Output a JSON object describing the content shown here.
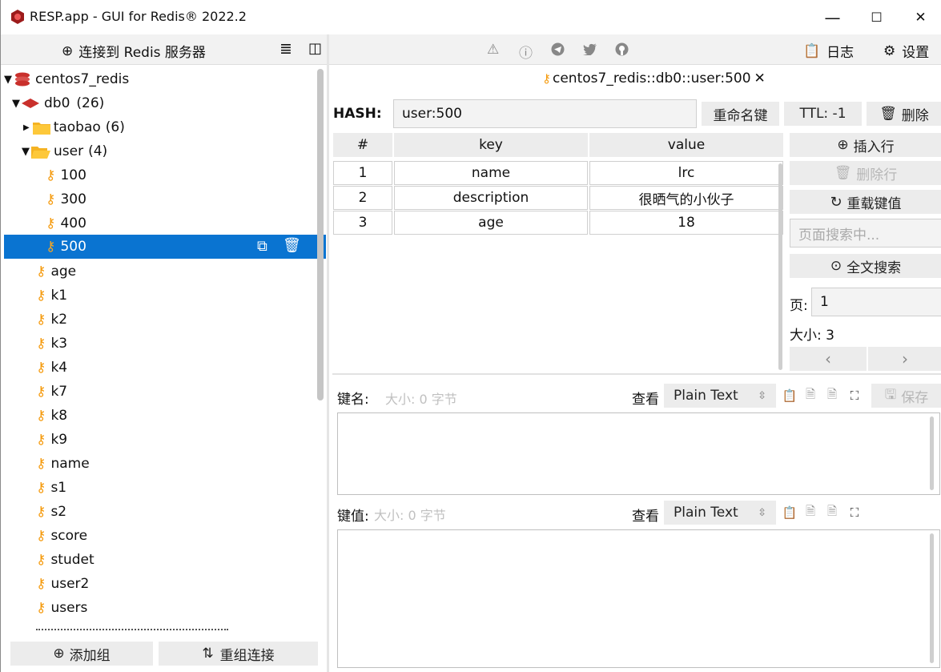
{
  "window": {
    "title": "RESP.app - GUI for Redis® 2022.2",
    "minimize": "—",
    "maximize": "☐",
    "close": "✕"
  },
  "left_panel": {
    "connect_button": "连接到 Redis 服务器",
    "list_icon": "≣",
    "panel_icon": "◫",
    "tree": {
      "connection": "centos7_redis",
      "db": "db0",
      "db_count": "(26)",
      "folders": [
        {
          "name": "taobao",
          "count": "(6)"
        },
        {
          "name": "user",
          "count": "(4)"
        }
      ],
      "user_keys": [
        "100",
        "300",
        "400",
        "500"
      ],
      "keys": [
        "age",
        "k1",
        "k2",
        "k3",
        "k4",
        "k7",
        "k8",
        "k9",
        "name",
        "s1",
        "s2",
        "score",
        "studet",
        "user2",
        "users"
      ]
    },
    "add_group_button": "添加组",
    "regroup_button": "重组连接"
  },
  "toolbar": {
    "log_button": "日志",
    "settings_button": "设置"
  },
  "tab": {
    "title": "centos7_redis::db0::user:500",
    "close": "✕"
  },
  "key_header": {
    "type_label": "HASH:",
    "key_name": "user:500",
    "rename_button": "重命名键",
    "ttl_button": "TTL:  -1",
    "delete_button": "删除"
  },
  "table": {
    "headers": [
      "#",
      "key",
      "value"
    ],
    "rows": [
      {
        "index": "1",
        "key": "name",
        "value": "lrc"
      },
      {
        "index": "2",
        "key": "description",
        "value": "很晒气的小伙子"
      },
      {
        "index": "3",
        "key": "age",
        "value": "18"
      }
    ]
  },
  "side_actions": {
    "insert_row": "插入行",
    "delete_row": "删除行",
    "reload": "重载键值",
    "search_placeholder": "页面搜索中...",
    "fulltext_search": "全文搜索",
    "page_label": "页:",
    "page_value": "1",
    "size_label": "大小: 3",
    "prev": "‹",
    "next": "›"
  },
  "editor": {
    "key_name_label": "键名:",
    "key_size": "大小: 0 字节",
    "view_label": "查看",
    "format": "Plain Text",
    "save_button": "保存",
    "key_value_label": "键值:",
    "value_size": "大小: 0 字节",
    "view_label2": "查看",
    "format2": "Plain Text"
  }
}
